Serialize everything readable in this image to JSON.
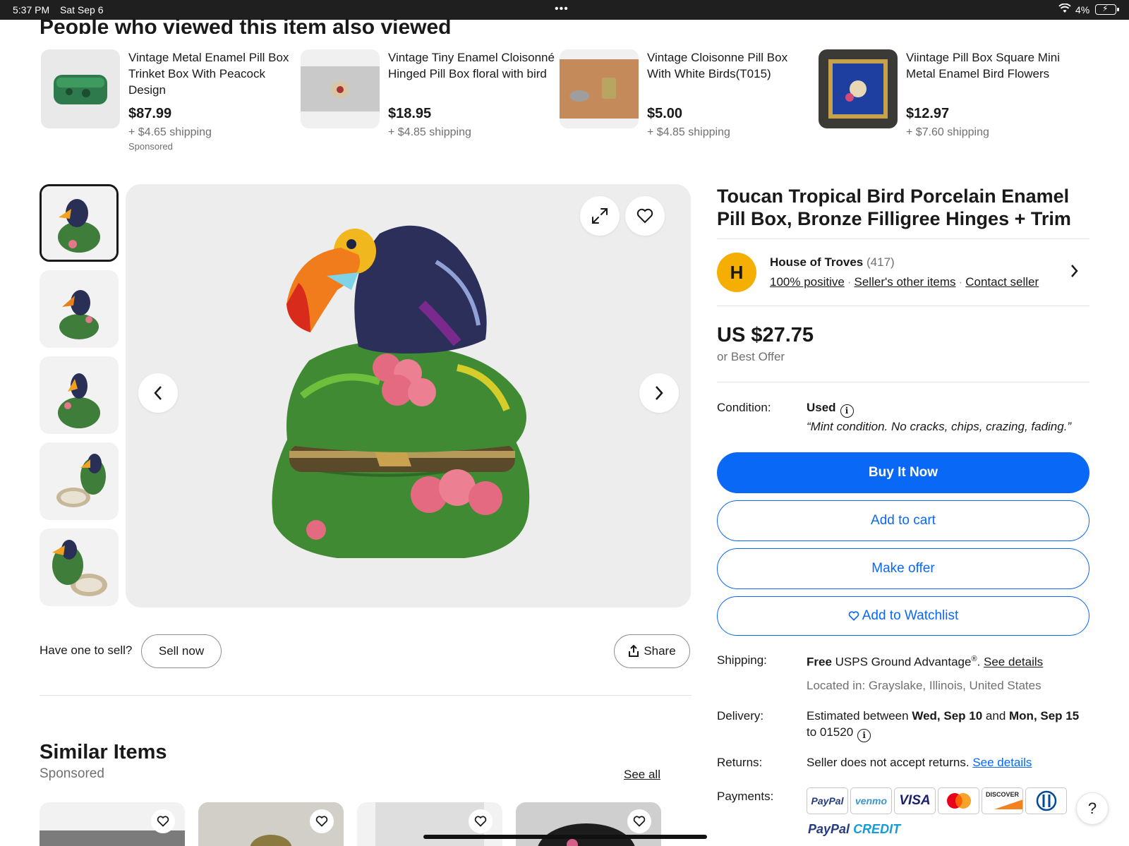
{
  "status_bar": {
    "time": "5:37 PM",
    "date": "Sat Sep 6",
    "battery": "4%"
  },
  "also_viewed": {
    "title": "People who viewed this item also viewed",
    "items": [
      {
        "name": "Vintage Metal Enamel Pill Box Trinket Box With Peacock Design",
        "price": "$87.99",
        "shipping": "+ $4.65 shipping",
        "sponsored": "Sponsored"
      },
      {
        "name": "Vintage Tiny Enamel Cloisonné Hinged Pill Box floral with bird",
        "price": "$18.95",
        "shipping": "+ $4.85 shipping"
      },
      {
        "name": "Vintage Cloisonne Pill Box With White Birds(T015)",
        "price": "$5.00",
        "shipping": "+ $4.85 shipping"
      },
      {
        "name": "Viintage Pill Box Square Mini Metal Enamel Bird Flowers",
        "price": "$12.97",
        "shipping": "+ $7.60 shipping"
      }
    ]
  },
  "gallery": {
    "thumb_count": 5
  },
  "sell": {
    "question": "Have one to sell?",
    "sell_now": "Sell now",
    "share": "Share"
  },
  "similar": {
    "title": "Similar Items",
    "sponsored": "Sponsored",
    "see_all": "See all"
  },
  "listing": {
    "title": "Toucan Tropical Bird Porcelain Enamel Pill Box, Bronze Filligree Hinges + Trim",
    "seller": {
      "initial": "H",
      "name": "House of Troves",
      "count": "(417)",
      "positive": "100% positive",
      "other_items": "Seller's other items",
      "contact": "Contact seller"
    },
    "price": "US $27.75",
    "best_offer": "or Best Offer",
    "condition_label": "Condition:",
    "condition": "Used",
    "condition_note": "“Mint condition. No cracks, chips, crazing, fading.”",
    "buy_now": "Buy It Now",
    "add_to_cart": "Add to cart",
    "make_offer": "Make offer",
    "add_watchlist": "Add to Watchlist",
    "shipping_label": "Shipping:",
    "shipping_free": "Free",
    "shipping_service": "USPS Ground Advantage",
    "shipping_reg": "®",
    "see_details": "See details",
    "located": "Located in: Grayslake, Illinois, United States",
    "delivery_label": "Delivery:",
    "delivery_est": "Estimated between",
    "delivery_from": "Wed, Sep 10",
    "delivery_and": "and",
    "delivery_to": "Mon, Sep 15",
    "delivery_zip": "to 01520",
    "returns_label": "Returns:",
    "returns_text": "Seller does not accept returns.",
    "payments_label": "Payments:",
    "payments": [
      "PayPal",
      "venmo",
      "VISA",
      "Mastercard",
      "DISCOVER",
      "Diners Club"
    ],
    "paypal_credit_a": "PayPal",
    "paypal_credit_b": "CREDIT"
  },
  "colors": {
    "primary_blue": "#0968f6",
    "seller_avatar": "#f5af02",
    "text": "#191919",
    "muted": "#707070"
  }
}
